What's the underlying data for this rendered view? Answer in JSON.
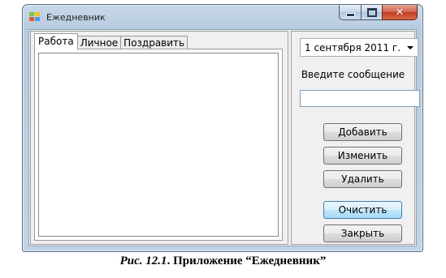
{
  "window": {
    "title": "Ежедневник",
    "controls": {
      "minimize": "–",
      "maximize": "□",
      "close": "✕"
    }
  },
  "tabs": [
    {
      "label": "Работа",
      "active": true
    },
    {
      "label": "Личное",
      "active": false
    },
    {
      "label": "Поздравить",
      "active": false
    }
  ],
  "side": {
    "date_value": "1 сентября 2011 г.",
    "prompt": "Введите сообщение",
    "message_value": "",
    "buttons": {
      "add": "Добавить",
      "edit": "Изменить",
      "delete": "Удалить",
      "clear": "Очистить",
      "close": "Закрыть"
    }
  },
  "figure_caption": {
    "prefix": "Рис. 12.1",
    "text": ". Приложение “Ежедневник”"
  },
  "colors": {
    "title_bar": "#c3d4e6",
    "close_button": "#c9432b",
    "hot_button": "#bee6fd"
  },
  "icons": {
    "app": "app-icon",
    "minimize": "minimize-icon",
    "maximize": "maximize-icon",
    "close": "close-icon",
    "dropdown": "chevron-down-icon"
  }
}
